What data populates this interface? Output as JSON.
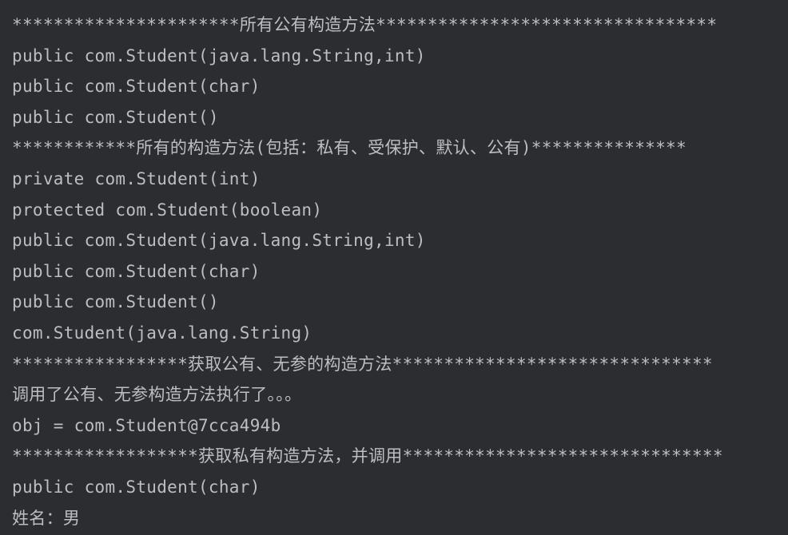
{
  "console": {
    "lines": [
      "**********************所有公有构造方法*********************************",
      "public com.Student(java.lang.String,int)",
      "public com.Student(char)",
      "public com.Student()",
      "************所有的构造方法(包括：私有、受保护、默认、公有)***************",
      "private com.Student(int)",
      "protected com.Student(boolean)",
      "public com.Student(java.lang.String,int)",
      "public com.Student(char)",
      "public com.Student()",
      "com.Student(java.lang.String)",
      "*****************获取公有、无参的构造方法*******************************",
      "调用了公有、无参构造方法执行了。。。",
      "obj = com.Student@7cca494b",
      "******************获取私有构造方法，并调用*******************************",
      "public com.Student(char)",
      "姓名：男"
    ]
  }
}
